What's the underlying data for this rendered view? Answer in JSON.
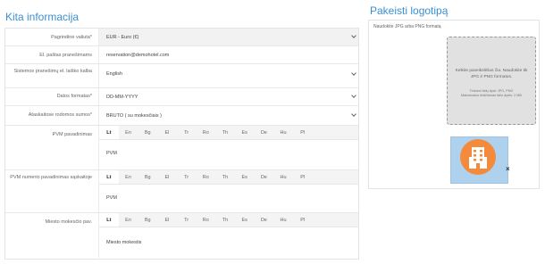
{
  "page": {
    "title": "Kita informacija",
    "logo_title": "Pakeisti logotipą"
  },
  "form": {
    "currency": {
      "label": "Pagrindinė valiuta*",
      "value": "EUR - Euro (€)"
    },
    "email": {
      "label": "El. paštas pranešimams",
      "value": "reservation@demohotel.com"
    },
    "language": {
      "label": "Sistemos pranešimų el. laiško kalba",
      "value": "English"
    },
    "date_format": {
      "label": "Datos formatas*",
      "value": "DD-MM-YYYY"
    },
    "price_display": {
      "label": "Ataskaitose rodomos sumos*",
      "value": "BRUTO ( su mokesčiais )"
    },
    "vat_name": {
      "label": "PVM pavadinimas",
      "value": "PVM"
    },
    "vat_number_name": {
      "label": "PVM numerio pavadinimas sąskaitoje",
      "value": "PVM"
    },
    "city_tax": {
      "label": "Miesto mokesčio pav.",
      "value": "Miesto mokestis"
    }
  },
  "language_tabs": [
    "Lt",
    "En",
    "Bg",
    "El",
    "Tr",
    "Ro",
    "Th",
    "Es",
    "De",
    "Hu",
    "Pl"
  ],
  "logo": {
    "hint": "Naudokite JPG arba PNG formatą",
    "dropzone_text": "Kelkite paveikslėlius čia. Naudokite tik JPG ir PNG formatus.",
    "dropzone_formats": "Tinkami failų tipai: JPG, PNG",
    "dropzone_size": "Maksimalus leidžiamas failo dydis: 2 MB",
    "remove": "×"
  },
  "colors": {
    "accent": "#3a8fd3",
    "logo_bg": "#aed2ee",
    "logo_icon": "#f48a3b"
  }
}
